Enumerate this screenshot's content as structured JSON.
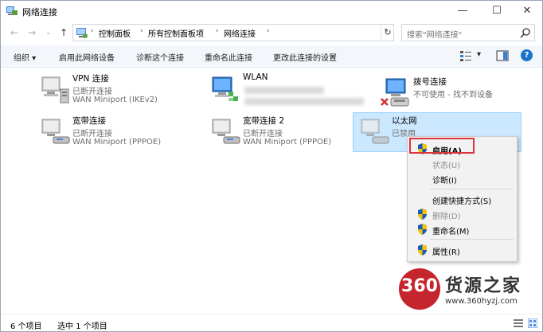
{
  "window": {
    "title": "网络连接",
    "buttons": {
      "minimize": "—",
      "maximize": "☐",
      "close": "✕"
    }
  },
  "nav": {
    "back": "←",
    "forward": "→",
    "recent": "⌄",
    "up": "↑",
    "breadcrumb": [
      "控制面板",
      "所有控制面板项",
      "网络连接"
    ],
    "dropdown": "⌄",
    "refresh": "↻",
    "search_placeholder": "搜索\"网络连接\""
  },
  "toolbar": {
    "items": [
      "组织 ▾",
      "启用此网络设备",
      "诊断这个连接",
      "重命名此连接",
      "更改此连接的设置"
    ],
    "view_dd": "▾",
    "help": "?"
  },
  "connections": [
    {
      "name": "VPN 连接",
      "status": "已断开连接",
      "device": "WAN Miniport (IKEv2)",
      "icon": "vpn-icon"
    },
    {
      "name": "WLAN",
      "status": "",
      "device": "",
      "icon": "wifi-adapter-icon"
    },
    {
      "name": "拨号连接",
      "status": "不可使用 - 找不到设备",
      "device": "",
      "icon": "dialup-icon"
    },
    {
      "name": "宽带连接",
      "status": "已断开连接",
      "device": "WAN Miniport (PPPOE)",
      "icon": "broadband-icon"
    },
    {
      "name": "宽带连接 2",
      "status": "已断开连接",
      "device": "WAN Miniport (PPPOE)",
      "icon": "broadband-icon"
    },
    {
      "name": "以太网",
      "status": "已禁用",
      "device": "",
      "icon": "ethernet-icon"
    }
  ],
  "context_menu": {
    "items": [
      {
        "label": "启用(A)",
        "shield": true,
        "bold": true,
        "disabled": false
      },
      {
        "label": "状态(U)",
        "shield": false,
        "disabled": true
      },
      {
        "label": "诊断(I)",
        "shield": false,
        "disabled": false
      },
      {
        "label": "创建快捷方式(S)",
        "shield": false,
        "disabled": false
      },
      {
        "label": "删除(D)",
        "shield": true,
        "disabled": true
      },
      {
        "label": "重命名(M)",
        "shield": true,
        "disabled": false
      },
      {
        "label": "属性(R)",
        "shield": true,
        "disabled": false
      }
    ]
  },
  "statusbar": {
    "count": "6 个项目",
    "selected": "选中 1 个项目"
  },
  "watermark": {
    "logo": "360",
    "name": "货源之家",
    "url": "www.360hyzj.com"
  },
  "colors": {
    "accent": "#0078d7",
    "selection": "#cce8ff",
    "highlight": "#d9363e",
    "brand_red": "#c5252c"
  }
}
